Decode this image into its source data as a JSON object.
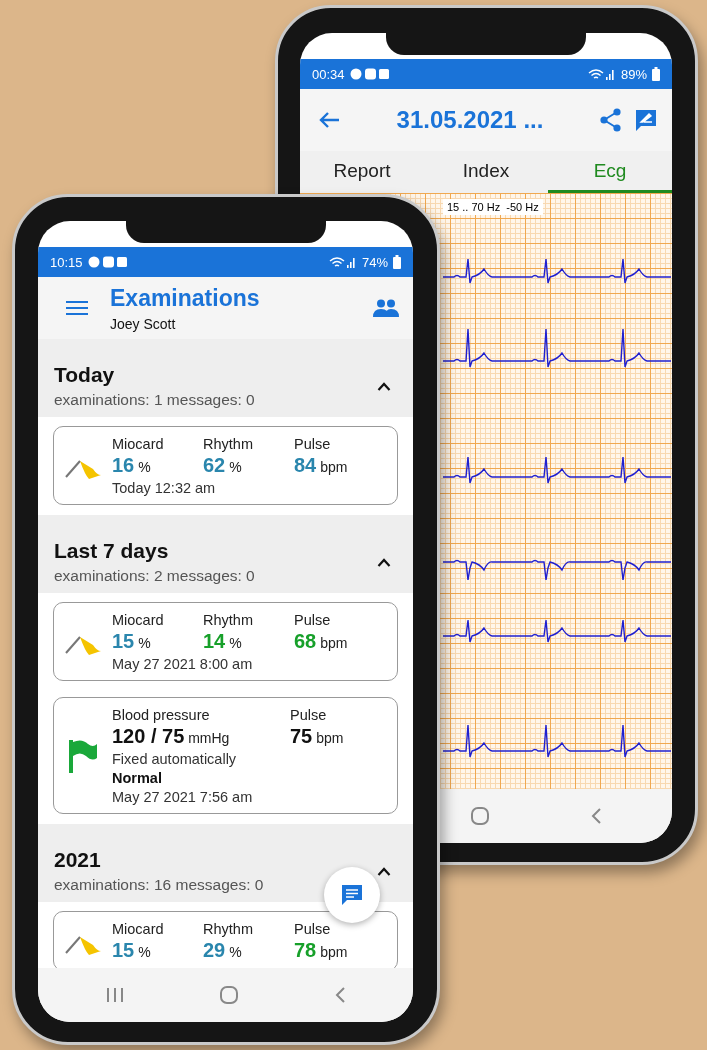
{
  "back_phone": {
    "status_bar": {
      "time": "00:34",
      "battery": "89%"
    },
    "app_bar": {
      "title": "31.05.2021 ..."
    },
    "tabs": [
      {
        "label": "Report",
        "selected": false
      },
      {
        "label": "Index",
        "selected": false
      },
      {
        "label": "Ecg",
        "selected": true
      }
    ],
    "ecg": {
      "filter": "15 .. 70 Hz  -50 Hz"
    }
  },
  "front_phone": {
    "status_bar": {
      "time": "10:15",
      "battery": "74%"
    },
    "header": {
      "title": "Examinations",
      "subtitle": "Joey Scott"
    },
    "sections": [
      {
        "title": "Today",
        "summary": "examinations: 1 messages: 0",
        "expanded": true,
        "cards": [
          {
            "kind": "ecg",
            "color": "#f5c400",
            "metrics": [
              {
                "label": "Miocard",
                "value": "16",
                "unit": "%",
                "color": "#2a86ad"
              },
              {
                "label": "Rhythm",
                "value": "62",
                "unit": "%",
                "color": "#2a86ad"
              },
              {
                "label": "Pulse",
                "value": "84",
                "unit": "bpm",
                "color": "#2a86ad"
              }
            ],
            "date": "Today 12:32 am"
          }
        ]
      },
      {
        "title": "Last 7 days",
        "summary": "examinations: 2 messages: 0",
        "expanded": true,
        "cards": [
          {
            "kind": "ecg",
            "color": "#f5c400",
            "metrics": [
              {
                "label": "Miocard",
                "value": "15",
                "unit": "%",
                "color": "#2a86ad"
              },
              {
                "label": "Rhythm",
                "value": "14",
                "unit": "%",
                "color": "#17a02a"
              },
              {
                "label": "Pulse",
                "value": "68",
                "unit": "bpm",
                "color": "#17a02a"
              }
            ],
            "date": "May 27 2021 8:00 am"
          },
          {
            "kind": "pressure",
            "color": "#1aa83a",
            "metrics": [
              {
                "label": "Blood pressure",
                "value": "120 / 75",
                "unit": "mmHg",
                "color": "#111111"
              },
              {
                "label": "Pulse",
                "value": "75",
                "unit": "bpm",
                "color": "#111111"
              }
            ],
            "note": "Fixed automatically",
            "verdict": "Normal",
            "date": "May 27 2021 7:56 am"
          }
        ]
      },
      {
        "title": "2021",
        "summary": "examinations: 16 messages: 0",
        "expanded": true,
        "cards": [
          {
            "kind": "ecg",
            "color": "#f5c400",
            "metrics": [
              {
                "label": "Miocard",
                "value": "15",
                "unit": "%",
                "color": "#2a86ad"
              },
              {
                "label": "Rhythm",
                "value": "29",
                "unit": "%",
                "color": "#2a86ad"
              },
              {
                "label": "Pulse",
                "value": "78",
                "unit": "bpm",
                "color": "#17a02a"
              }
            ]
          }
        ]
      }
    ]
  }
}
